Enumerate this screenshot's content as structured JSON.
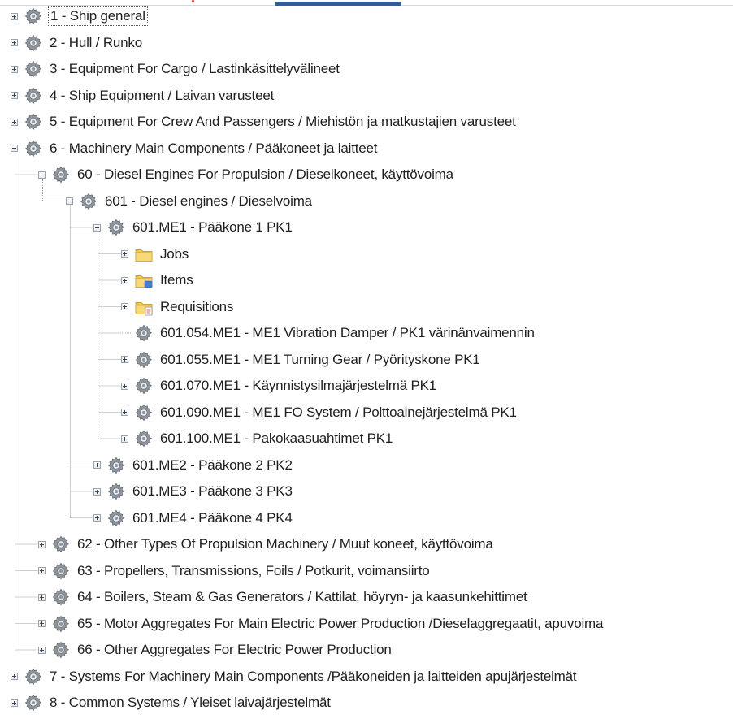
{
  "tree": {
    "rows": [
      {
        "label": "1 - Ship general",
        "level": 0,
        "icon": "gear-icon",
        "expander": "plus",
        "selected": true
      },
      {
        "label": "2 - Hull / Runko",
        "level": 0,
        "icon": "gear-icon",
        "expander": "plus"
      },
      {
        "label": "3 - Equipment For Cargo / Lastinkäsittelyvälineet",
        "level": 0,
        "icon": "gear-icon",
        "expander": "plus"
      },
      {
        "label": "4 - Ship Equipment / Laivan varusteet",
        "level": 0,
        "icon": "gear-icon",
        "expander": "plus"
      },
      {
        "label": "5 - Equipment For Crew And Passengers / Miehistön ja matkustajien varusteet",
        "level": 0,
        "icon": "gear-icon",
        "expander": "plus"
      },
      {
        "label": "6 - Machinery Main Components / Pääkoneet ja laitteet",
        "level": 0,
        "icon": "gear-icon",
        "expander": "minus"
      },
      {
        "label": "60 - Diesel Engines For Propulsion / Dieselkoneet, käyttövoima",
        "level": 1,
        "icon": "gear-icon",
        "expander": "minus"
      },
      {
        "label": "601 - Diesel engines / Dieselvoima",
        "level": 2,
        "icon": "gear-icon",
        "expander": "minus"
      },
      {
        "label": "601.ME1 - Pääkone 1 PK1",
        "level": 3,
        "icon": "gear-icon",
        "expander": "minus"
      },
      {
        "label": "Jobs",
        "level": 4,
        "icon": "jobs-folder-icon",
        "expander": "plus"
      },
      {
        "label": "Items",
        "level": 4,
        "icon": "items-folder-icon",
        "expander": "plus"
      },
      {
        "label": "Requisitions",
        "level": 4,
        "icon": "requisitions-folder-icon",
        "expander": "plus"
      },
      {
        "label": "601.054.ME1 - ME1 Vibration Damper / PK1 värinänvaimennin",
        "level": 4,
        "icon": "gear-icon",
        "expander": "none"
      },
      {
        "label": "601.055.ME1 - ME1 Turning Gear / Pyörityskone PK1",
        "level": 4,
        "icon": "gear-icon",
        "expander": "plus"
      },
      {
        "label": "601.070.ME1 - Käynnistysilmajärjestelmä PK1",
        "level": 4,
        "icon": "gear-icon",
        "expander": "plus"
      },
      {
        "label": "601.090.ME1 - ME1 FO System / Polttoainejärjestelmä PK1",
        "level": 4,
        "icon": "gear-icon",
        "expander": "plus"
      },
      {
        "label": "601.100.ME1 - Pakokaasuahtimet PK1",
        "level": 4,
        "icon": "gear-icon",
        "expander": "plus"
      },
      {
        "label": "601.ME2 - Pääkone 2 PK2",
        "level": 3,
        "icon": "gear-icon",
        "expander": "plus"
      },
      {
        "label": "601.ME3 - Pääkone 3 PK3",
        "level": 3,
        "icon": "gear-icon",
        "expander": "plus"
      },
      {
        "label": "601.ME4 - Pääkone 4 PK4",
        "level": 3,
        "icon": "gear-icon",
        "expander": "plus"
      },
      {
        "label": "62 - Other Types Of Propulsion Machinery / Muut koneet, käyttövoima",
        "level": 1,
        "icon": "gear-icon",
        "expander": "plus"
      },
      {
        "label": "63 - Propellers, Transmissions, Foils / Potkurit, voimansiirto",
        "level": 1,
        "icon": "gear-icon",
        "expander": "plus"
      },
      {
        "label": "64 - Boilers, Steam & Gas Generators / Kattilat, höyryn- ja kaasunkehittimet",
        "level": 1,
        "icon": "gear-icon",
        "expander": "plus"
      },
      {
        "label": "65 - Motor Aggregates For Main Electric Power Production /Dieselaggregaatit, apuvoima",
        "level": 1,
        "icon": "gear-icon",
        "expander": "plus"
      },
      {
        "label": "66 - Other Aggregates For Electric Power Production",
        "level": 1,
        "icon": "gear-icon",
        "expander": "plus"
      },
      {
        "label": "7 - Systems For Machinery Main Components /Pääkoneiden ja laitteiden apujärjestelmät",
        "level": 0,
        "icon": "gear-icon",
        "expander": "plus"
      },
      {
        "label": "8 - Common Systems / Yleiset laivajärjestelmät",
        "level": 0,
        "icon": "gear-icon",
        "expander": "plus"
      }
    ]
  },
  "colors": {
    "text": "#1f1f1f",
    "tree_line": "#a0a0a0",
    "gear": "#8d949c",
    "folder": "#f1c84b",
    "accent_tab": "#2f5f93"
  }
}
